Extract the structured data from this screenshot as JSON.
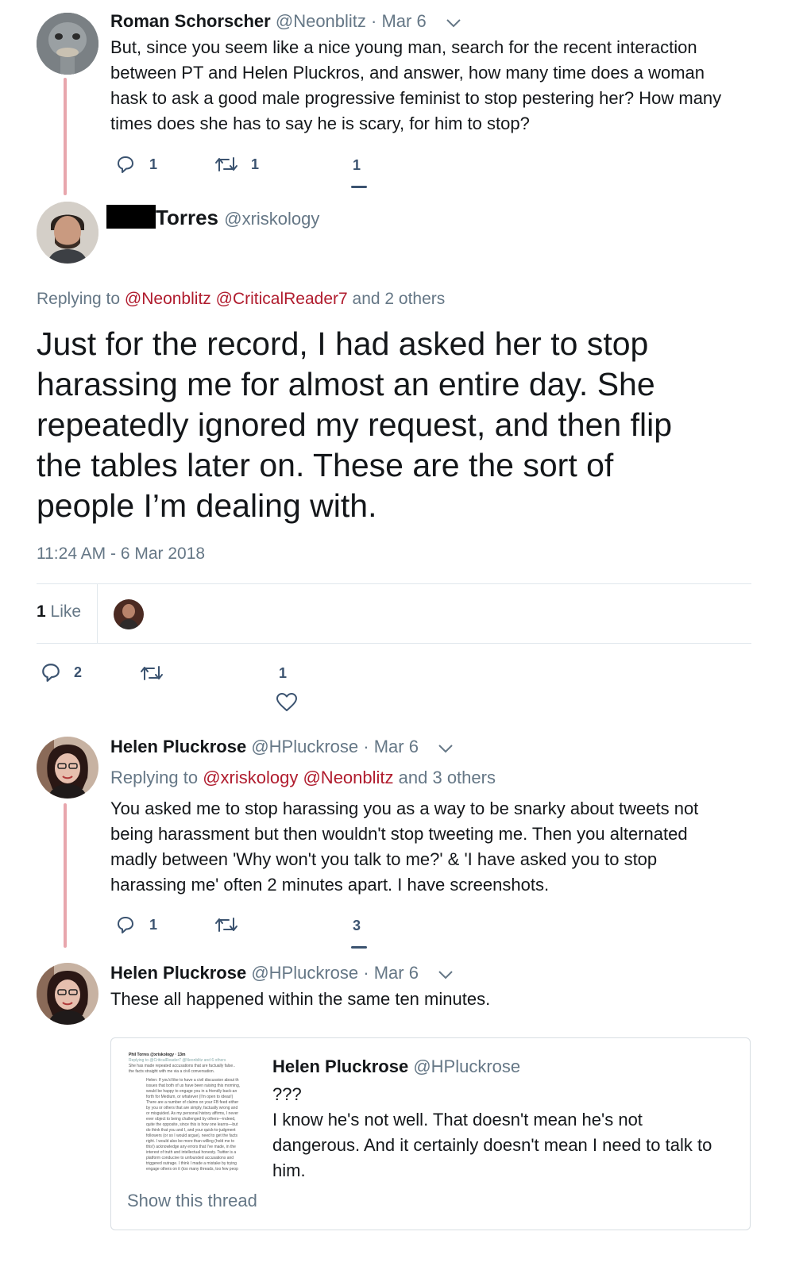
{
  "colors": {
    "link": "#b01c2e",
    "thread_line": "#e8a6ad",
    "muted": "#657786",
    "text": "#14171a"
  },
  "tweet1": {
    "name": "Roman Schorscher",
    "handle": "@Neonblitz",
    "date": "· Mar 6",
    "avatar_icon": "ostrich-photo",
    "lines": [
      "But, since you seem like a nice young man, search for the recent interaction",
      "between PT and Helen Pluckros, and answer, how many time does a woman",
      "hask to ask a good male progressive feminist to stop pestering her? How many",
      "times does she has to say he is scary, for him to stop?"
    ],
    "replies": "1",
    "retweets": "1",
    "likes": "1"
  },
  "main": {
    "name": "Torres",
    "handle": "@xriskology",
    "replying_prefix": "Replying to",
    "replying_users": [
      "@Neonblitz",
      "@CriticalReader7"
    ],
    "replying_suffix": "and 2 others",
    "lines": [
      "Just for the record, I had asked her to stop",
      "harassing me for almost an entire day. She",
      "repeatedly ignored my request, and then flip",
      "the tables later on. These are the sort of",
      "people I’m dealing with."
    ],
    "timestamp": "11:24 AM - 6 Mar 2018",
    "like_count": "1",
    "like_label": "Like",
    "replies": "2",
    "retweets": "",
    "likes": "1"
  },
  "tweet3": {
    "name": "Helen Pluckrose",
    "handle": "@HPluckrose",
    "date": "· Mar 6",
    "replying_prefix": "Replying to",
    "replying_users": [
      "@xriskology",
      "@Neonblitz"
    ],
    "replying_suffix": "and 3 others",
    "lines": [
      "You asked me to stop harassing you as a way to be snarky about tweets not",
      "being harassment but then wouldn't stop tweeting me. Then you alternated",
      "madly between 'Why won't you talk to me?' & 'I have asked you to stop",
      "harassing me' often 2 minutes apart. I have screenshots."
    ],
    "replies": "1",
    "retweets": "",
    "likes": "3"
  },
  "tweet4": {
    "name": "Helen Pluckrose",
    "handle": "@HPluckrose",
    "date": "· Mar 6",
    "text": "These all happened within the same ten minutes.",
    "quote": {
      "name": "Helen Pluckrose",
      "handle": "@HPluckrose",
      "lines": [
        "???",
        "I know he's not well. That doesn't mean he's not",
        "dangerous. And it certainly doesn't mean I need to talk to",
        "him."
      ],
      "show_thread": "Show this thread",
      "thumb_header": "Phil Torres @xriskology · 13m",
      "thumb_reply": "Replying to @CriticalReader7 @Neonblitz and 6 others",
      "thumb_intro": [
        "She has made repeated accusations that are factually false..",
        "the facts straight with me via a civil conversation."
      ],
      "thumb_body": [
        "Helen: If you'd like to have a civil discussion about th",
        "issues that both of us have been raising this morning,",
        "would be happy to engage you in a friendly back-an",
        "forth for Medium, or whatever (I'm open to ideas!)",
        "There are a number of claims on your FB feed either",
        "by you or others that are simply, factually wrong and",
        "or misguided. As my personal history affirms, I never",
        "ever object to being challenged by others—indeed,",
        "quite the opposite, since this is how one learns—but",
        "do think that you and I, and your quick-to-judgment",
        "followers (or so I would argue), need to get the facts",
        "right. I would also be more than willing (hold me to",
        "this!) acknowledge any errors that I've made, in the",
        "interest of truth and intellectual honesty. Twitter is a",
        "platform conducive to unfounded accusations and",
        "triggered outrage. I think I made a mistake by trying",
        "engage others on it (too many threads, too few peop"
      ]
    }
  }
}
